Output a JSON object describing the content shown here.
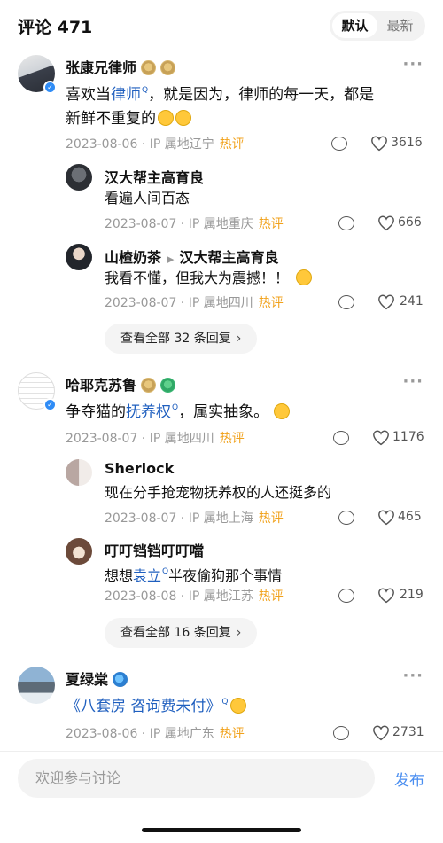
{
  "header": {
    "title": "评论 471",
    "tabs": [
      "默认",
      "最新"
    ]
  },
  "comments": [
    {
      "name": "张康兄律师",
      "text_a": "喜欢当",
      "link": "律师",
      "text_b": "，就是因为，律师的每一天，都是",
      "text_c": "新鲜不重复的",
      "date": "2023-08-06 · IP 属地辽宁",
      "hot": "热评",
      "likes": "3616",
      "replies": [
        {
          "name": "汉大帮主高育良",
          "text": "看遍人间百态",
          "date": "2023-08-07 · IP 属地重庆",
          "hot": "热评",
          "likes": "666"
        },
        {
          "name": "山楂奶茶",
          "reply_to": "汉大帮主高育良",
          "text": "我看不懂，但我大为震撼！！",
          "date": "2023-08-07 · IP 属地四川",
          "hot": "热评",
          "likes": "241"
        }
      ],
      "expand": "查看全部 32 条回复"
    },
    {
      "name": "哈耶克苏鲁",
      "text_a": "争夺猫的",
      "link": "抚养权",
      "text_b": "，属实抽象。",
      "date": "2023-08-07 · IP 属地四川",
      "hot": "热评",
      "likes": "1176",
      "replies": [
        {
          "name": "Sherlock",
          "text": "现在分手抢宠物抚养权的人还挺多的",
          "date": "2023-08-07 · IP 属地上海",
          "hot": "热评",
          "likes": "465"
        },
        {
          "name": "叮叮铛铛叮叮噹",
          "text_a": "想想",
          "link": "袁立",
          "text_b": "半夜偷狗那个事情",
          "date": "2023-08-08 · IP 属地江苏",
          "hot": "热评",
          "likes": "219"
        }
      ],
      "expand": "查看全部 16 条回复"
    },
    {
      "name": "夏绿棠",
      "link": "《八套房 咨询费未付》",
      "date": "2023-08-06 · IP 属地广东",
      "hot": "热评",
      "likes": "2731"
    }
  ],
  "composer": {
    "placeholder": "欢迎参与讨论",
    "send": "发布"
  },
  "icons": {
    "more": "more-dots-icon",
    "reply": "comment-bubble-icon",
    "like": "heart-icon",
    "verified": "verified-badge-icon",
    "link": "search-link-icon"
  },
  "colors": {
    "link": "#1f5fbf",
    "hot": "#f1a21c",
    "send": "#4a8ef0",
    "verified": "#2f8cf6"
  }
}
